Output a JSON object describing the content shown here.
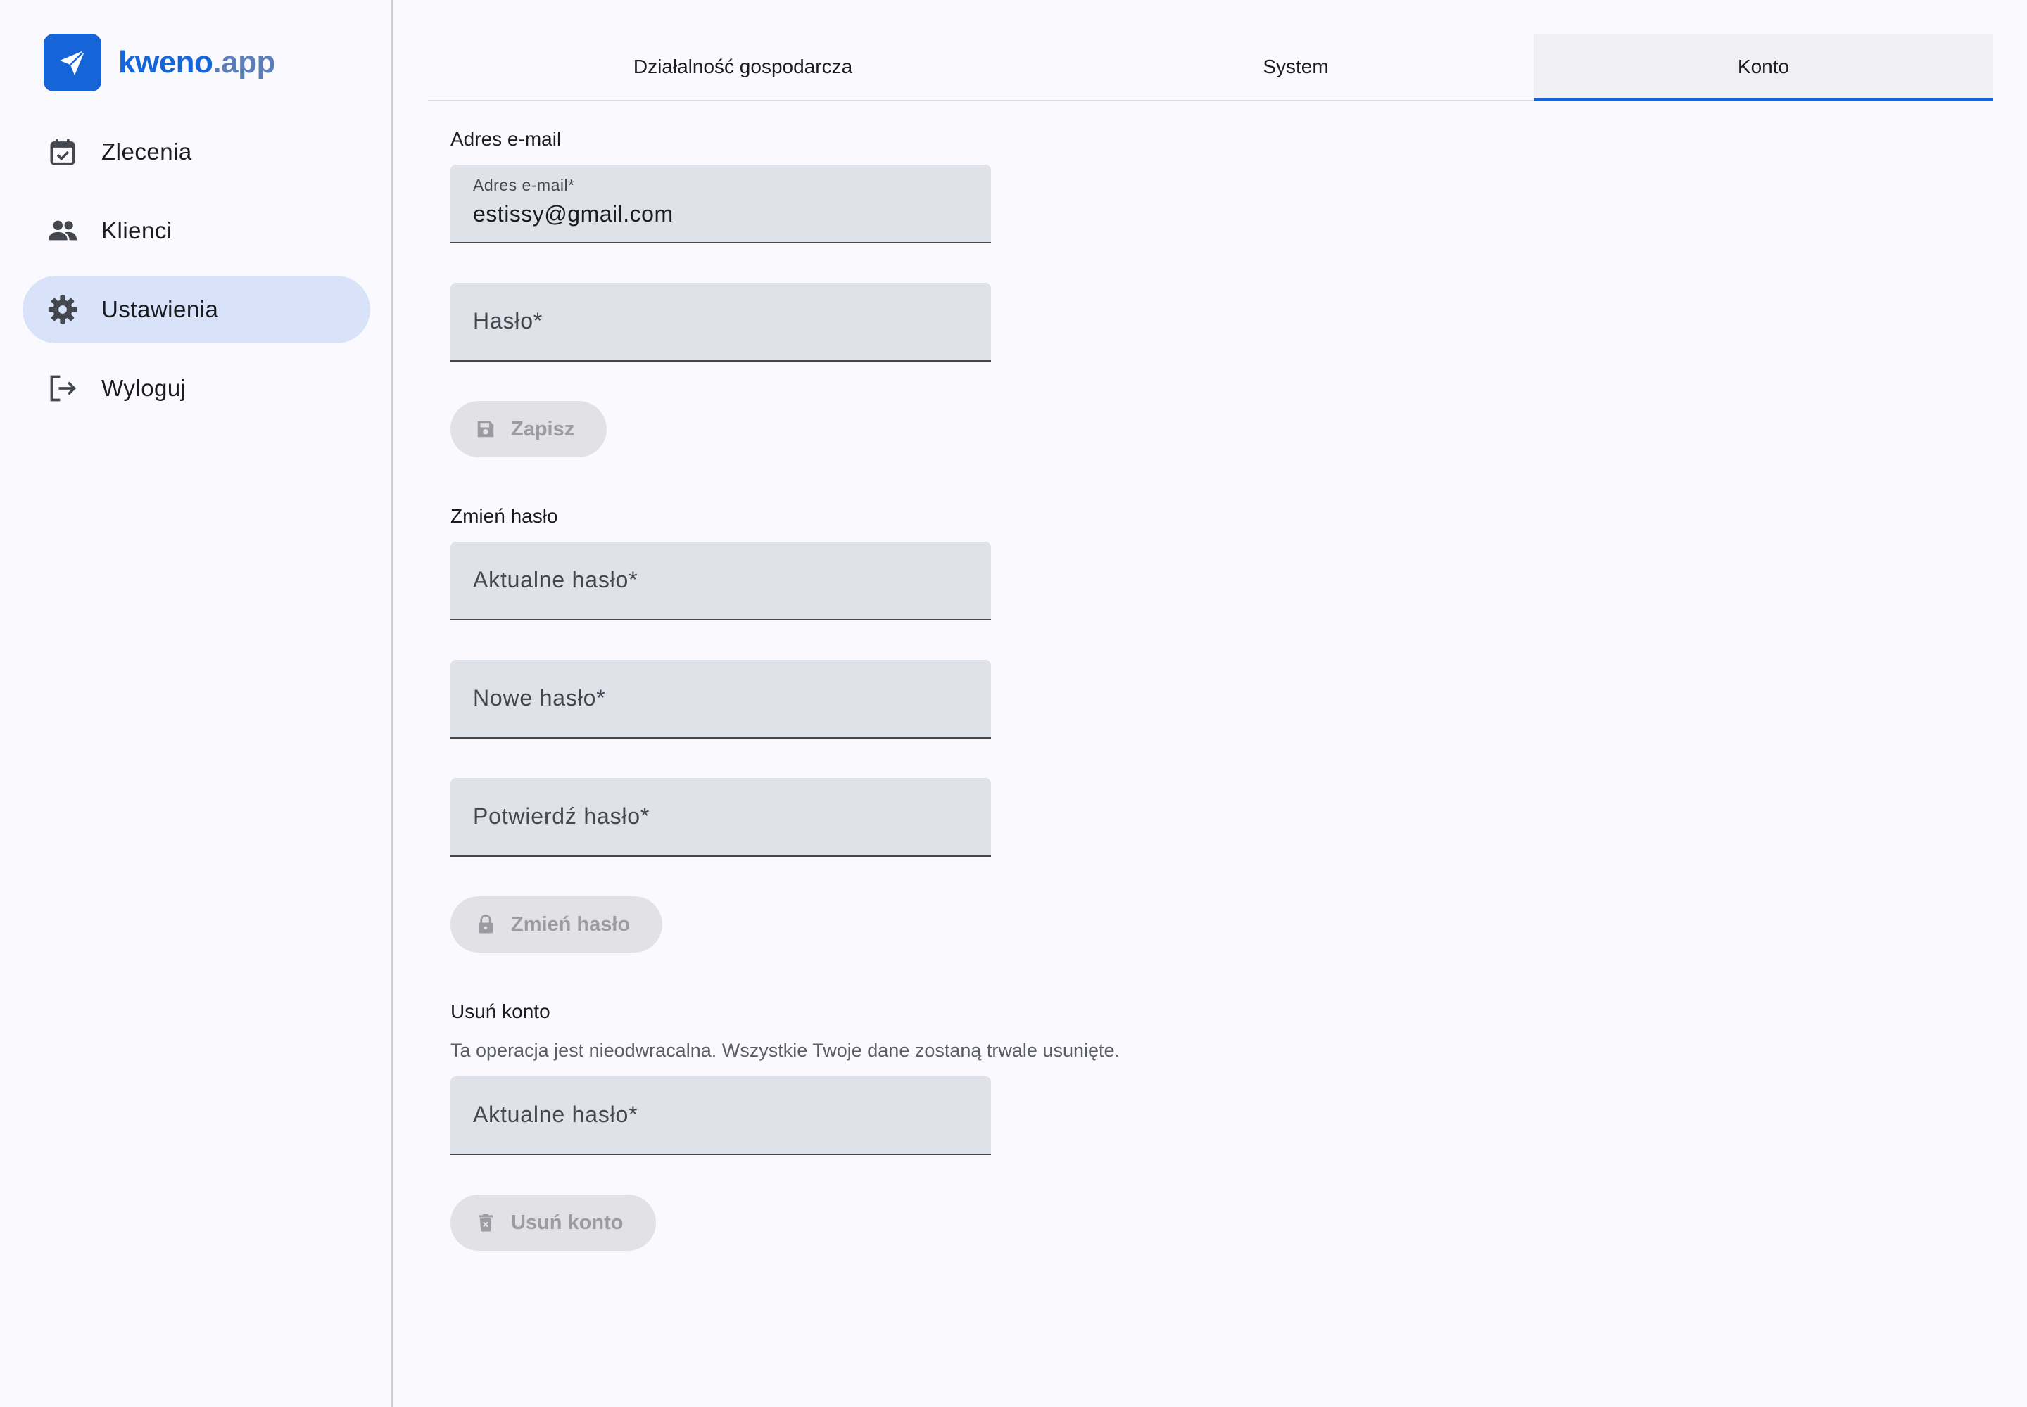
{
  "app": {
    "logo_primary": "kweno",
    "logo_secondary": ".app",
    "brand_color": "#1565d8"
  },
  "sidebar": {
    "items": [
      {
        "label": "Zlecenia",
        "icon": "calendar-check-icon",
        "active": false
      },
      {
        "label": "Klienci",
        "icon": "people-icon",
        "active": false
      },
      {
        "label": "Ustawienia",
        "icon": "gear-icon",
        "active": true
      },
      {
        "label": "Wyloguj",
        "icon": "logout-icon",
        "active": false
      }
    ]
  },
  "tabs": [
    {
      "label": "Działalność gospodarcza",
      "active": false
    },
    {
      "label": "System",
      "active": false
    },
    {
      "label": "Konto",
      "active": true
    }
  ],
  "email_section": {
    "title": "Adres e-mail",
    "email_label": "Adres e-mail*",
    "email_value": "estissy@gmail.com",
    "password_label": "Hasło*",
    "save_button": "Zapisz"
  },
  "change_password_section": {
    "title": "Zmień hasło",
    "current_password_label": "Aktualne hasło*",
    "new_password_label": "Nowe hasło*",
    "confirm_password_label": "Potwierdź hasło*",
    "change_button": "Zmień hasło"
  },
  "delete_account_section": {
    "title": "Usuń konto",
    "description": "Ta operacja jest nieodwracalna. Wszystkie Twoje dane zostaną trwale usunięte.",
    "current_password_label": "Aktualne hasło*",
    "delete_button": "Usuń konto"
  }
}
